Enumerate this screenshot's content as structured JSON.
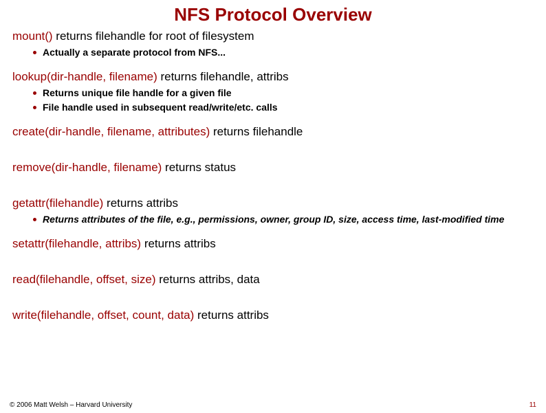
{
  "title": "NFS Protocol Overview",
  "points": {
    "mount": {
      "call": "mount()",
      "ret": " returns filehandle for root of filesystem"
    },
    "mount_sub": {
      "a": "Actually a separate protocol from NFS..."
    },
    "lookup": {
      "call": "lookup(dir-handle, filename)",
      "ret": " returns filehandle, attribs"
    },
    "lookup_sub": {
      "a": "Returns unique file handle for a given file",
      "b": "File handle used in subsequent read/write/etc. calls"
    },
    "create": {
      "call": "create(dir-handle, filename, attributes)",
      "ret": " returns filehandle"
    },
    "remove": {
      "call": "remove(dir-handle, filename)",
      "ret": " returns status"
    },
    "getattr": {
      "call": "getattr(filehandle)",
      "ret": " returns attribs"
    },
    "getattr_sub": {
      "a": "Returns attributes of the file, e.g., permissions, owner, group ID, size, access time, last-modified time"
    },
    "setattr": {
      "call": "setattr(filehandle, attribs)",
      "ret": " returns attribs"
    },
    "read": {
      "call": "read(filehandle, offset, size)",
      "ret": " returns attribs, data"
    },
    "write": {
      "call": "write(filehandle, offset, count, data)",
      "ret": " returns attribs"
    }
  },
  "footer": {
    "copyright": "© 2006 Matt Welsh – Harvard University",
    "page": "11"
  }
}
